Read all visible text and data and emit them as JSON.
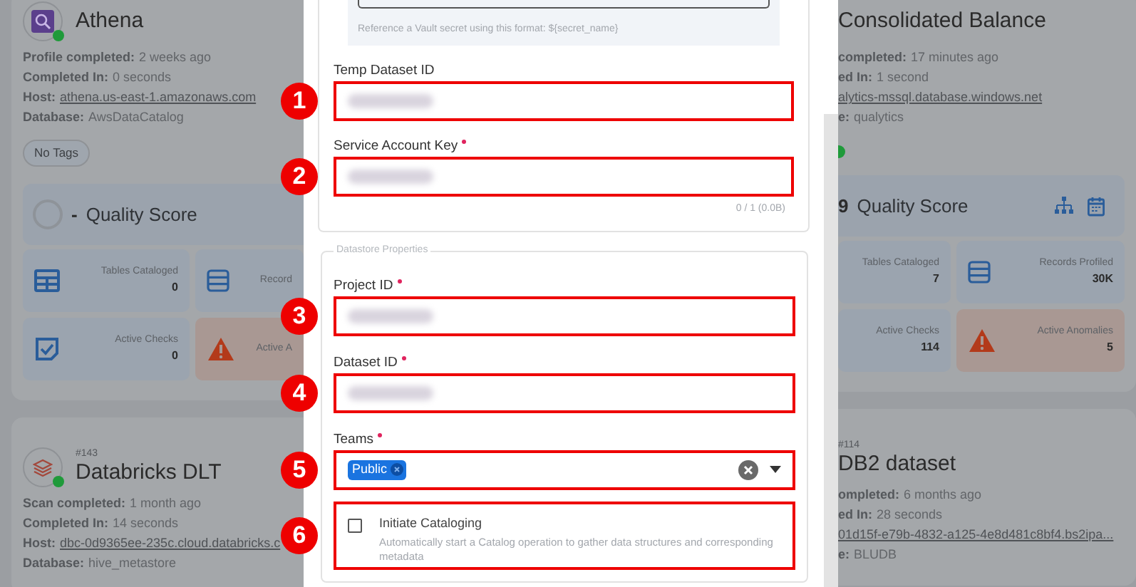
{
  "left_column": {
    "cards": [
      {
        "title": "Athena",
        "avatar": {
          "kind": "magnifier"
        },
        "online": true,
        "meta": [
          {
            "label": "Profile completed:",
            "value": "2 weeks ago"
          },
          {
            "label": "Completed In:",
            "value": "0 seconds"
          },
          {
            "label": "Host:",
            "value": "athena.us-east-1.amazonaws.com",
            "link": true
          },
          {
            "label": "Database:",
            "value": "AwsDataCatalog"
          }
        ],
        "tags": [
          "No Tags"
        ],
        "quality": {
          "score": "-",
          "label": "Quality Score"
        },
        "tiles": [
          {
            "kind": "tables",
            "label": "Tables Cataloged",
            "value": "0"
          },
          {
            "kind": "records",
            "label": "Record"
          },
          {
            "kind": "checks",
            "label": "Active Checks",
            "value": "0"
          },
          {
            "kind": "anomalies",
            "label": "Active A"
          }
        ]
      },
      {
        "number": "#143",
        "title": "Databricks DLT",
        "avatar": {
          "kind": "layers"
        },
        "online": true,
        "meta": [
          {
            "label": "Scan completed:",
            "value": "1 month ago"
          },
          {
            "label": "Completed In:",
            "value": "14 seconds"
          },
          {
            "label": "Host:",
            "value": "dbc-0d9365ee-235c.cloud.databricks.c",
            "link": true
          },
          {
            "label": "Database:",
            "value": "hive_metastore"
          }
        ]
      }
    ]
  },
  "right_column": {
    "cards": [
      {
        "title": "Consolidated Balance",
        "online": true,
        "meta": [
          {
            "label": "completed:",
            "value": "17 minutes ago"
          },
          {
            "label": "ed In:",
            "value": "1 second"
          },
          {
            "value": "alytics-mssql.database.windows.net",
            "link": true
          },
          {
            "label": "e:",
            "value": "qualytics"
          }
        ],
        "quality": {
          "score": "9",
          "label": "Quality Score"
        },
        "tiles": [
          {
            "kind": "plain",
            "label": "Tables Cataloged",
            "value": "7"
          },
          {
            "kind": "records",
            "label": "Records Profiled",
            "value": "30K"
          },
          {
            "kind": "plain",
            "label": "Active Checks",
            "value": "114"
          },
          {
            "kind": "anomalies",
            "label": "Active Anomalies",
            "value": "5"
          }
        ]
      },
      {
        "number": "#114",
        "title": "DB2 dataset",
        "meta": [
          {
            "label": "ompleted:",
            "value": "6 months ago"
          },
          {
            "label": "ed In:",
            "value": "28 seconds"
          },
          {
            "value": "01d15f-e79b-4832-a125-4e8d481c8bf4.bs2ipa...",
            "link": true
          },
          {
            "label": "e:",
            "value": "BLUDB"
          }
        ]
      }
    ]
  },
  "modal": {
    "vault_hint": "Reference a Vault secret using this format: ${secret_name}",
    "fields": [
      {
        "label": "Temp Dataset ID",
        "required": false,
        "redacted": true,
        "annotation": "1"
      },
      {
        "label": "Service Account Key",
        "required": true,
        "redacted": true,
        "annotation": "2",
        "counter": "0 / 1 (0.0B)"
      }
    ],
    "datastore_properties": {
      "legend": "Datastore Properties",
      "fields": [
        {
          "kind": "text",
          "label": "Project ID",
          "required": true,
          "redacted": true,
          "annotation": "3"
        },
        {
          "kind": "text",
          "label": "Dataset ID",
          "required": true,
          "redacted": true,
          "annotation": "4"
        },
        {
          "kind": "select",
          "label": "Teams",
          "required": true,
          "chips": [
            "Public"
          ],
          "annotation": "5"
        }
      ],
      "initiate": {
        "label": "Initiate Cataloging",
        "description": "Automatically start a Catalog operation to gather data structures and corresponding metadata",
        "checked": false,
        "annotation": "6"
      }
    }
  }
}
